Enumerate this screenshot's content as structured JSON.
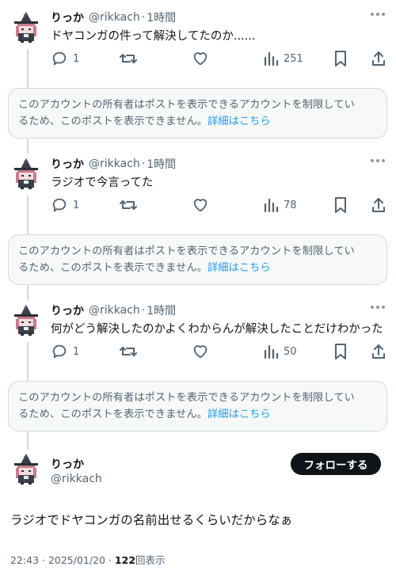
{
  "thread": [
    {
      "name": "りっか",
      "handle": "@rikkach",
      "time": "1時間",
      "text": "ドヤコンガの件って解決してたのか......",
      "replies": "1",
      "views": "251"
    },
    {
      "name": "りっか",
      "handle": "@rikkach",
      "time": "1時間",
      "text": "ラジオで今言ってた",
      "replies": "1",
      "views": "78"
    },
    {
      "name": "りっか",
      "handle": "@rikkach",
      "time": "1時間",
      "text": "何がどう解決したのかよくわからんが解決したことだけわかった",
      "replies": "1",
      "views": "50"
    }
  ],
  "notice": {
    "line1": "このアカウントの所有者はポストを表示できるアカウントを制限してい",
    "line2": "るため、このポストを表示できません。",
    "link": "詳細はこちら"
  },
  "main": {
    "name": "りっか",
    "handle": "@rikkach",
    "follow_label": "フォローする",
    "text": "ラジオでドヤコンガの名前出せるくらいだからなぁ",
    "timestamp": "22:43 · 2025/01/20 · ",
    "view_count": "122",
    "view_suffix": "回表示"
  },
  "icons": [
    "reply-icon",
    "repost-icon",
    "like-icon",
    "views-icon",
    "bookmark-icon",
    "share-icon",
    "more-icon"
  ],
  "colors": {
    "text": "#0f1419",
    "muted": "#536471",
    "link": "#1d9bf0",
    "notice_bg": "#f7f9f9",
    "border": "#cfd9de"
  }
}
